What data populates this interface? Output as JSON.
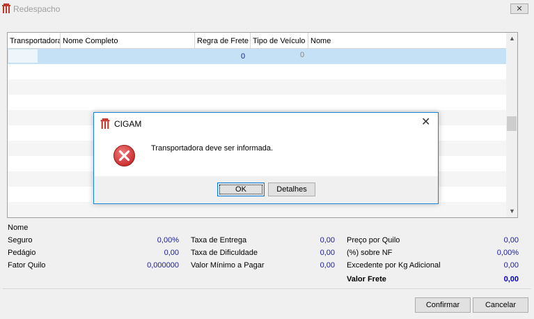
{
  "window": {
    "title": "Redespacho",
    "close_symbol": "✕"
  },
  "grid": {
    "columns": [
      "Transportadora",
      "Nome Completo",
      "Regra de Frete",
      "Tipo de Veículo",
      "Nome"
    ],
    "selected_row": {
      "regra_frete": "0",
      "tipo_veiculo": "0"
    },
    "scroll_up": "▲",
    "scroll_down": "▼"
  },
  "dialog": {
    "title": "CIGAM",
    "close_symbol": "✕",
    "message": "Transportadora deve ser informada.",
    "ok_label": "OK",
    "details_label": "Detalhes"
  },
  "summary": {
    "nome_label": "Nome",
    "seguro_label": "Seguro",
    "seguro_value": "0,00%",
    "pedagio_label": "Pedágio",
    "pedagio_value": "0,00",
    "fator_label": "Fator Quilo",
    "fator_value": "0,000000",
    "taxa_entrega_label": "Taxa de Entrega",
    "taxa_entrega_value": "0,00",
    "taxa_dificuldade_label": "Taxa de Dificuldade",
    "taxa_dificuldade_value": "0,00",
    "valor_minimo_label": "Valor Mínimo a Pagar",
    "valor_minimo_value": "0,00",
    "preco_quilo_label": "Preço por Quilo",
    "preco_quilo_value": "0,00",
    "sobre_nf_label": "(%) sobre NF",
    "sobre_nf_value": "0,00%",
    "excedente_label": "Excedente por Kg Adicional",
    "excedente_value": "0,00",
    "valor_frete_label": "Valor Frete",
    "valor_frete_value": "0,00"
  },
  "footer": {
    "confirm_label": "Confirmar",
    "cancel_label": "Cancelar"
  },
  "colors": {
    "accent": "#0078d7",
    "selection": "#c5e1f5",
    "value_text": "#1a1a9a",
    "error_red": "#d32f2f"
  },
  "icons": {
    "app": "cigam-logo-icon",
    "error": "error-x-icon"
  }
}
